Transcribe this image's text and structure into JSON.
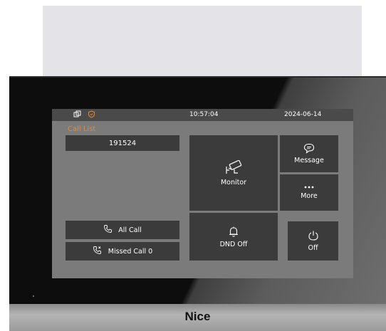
{
  "status_bar": {
    "time": "10:57:04",
    "date": "2024-06-14",
    "left_icons": [
      "copy-icon",
      "shield-icon"
    ]
  },
  "call_list": {
    "title": "Call List",
    "entries": [
      "191524"
    ]
  },
  "list_buttons": {
    "all_call": "All Call",
    "missed_call": "Missed Call 0"
  },
  "tiles": {
    "monitor": "Monitor",
    "message": "Message",
    "more": "More",
    "dnd": "DND Off",
    "off": "Off"
  },
  "brand": "Nice",
  "colors": {
    "accent": "#e08a3a",
    "tile": "#3b3b3b",
    "screen": "#7b7b7b",
    "status_bar": "#4a4a4a"
  }
}
